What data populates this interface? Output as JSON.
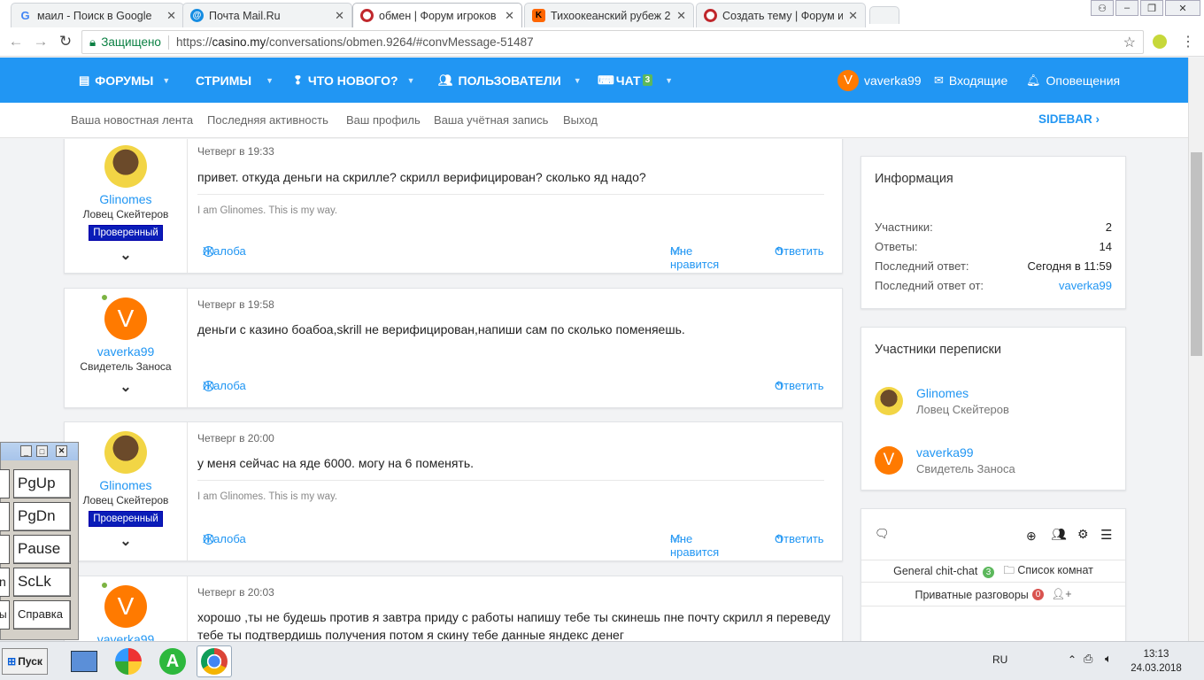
{
  "browser": {
    "tabs": [
      {
        "title": "маил - Поиск в Google",
        "favicon": "google-icon"
      },
      {
        "title": "Почта Mail.Ru",
        "favicon": "mail-ru-icon"
      },
      {
        "title": "обмен | Форум игроков",
        "favicon": "casino-icon",
        "active": true
      },
      {
        "title": "Тихоокеанский рубеж 2",
        "favicon": "kinopoisk-icon"
      },
      {
        "title": "Создать тему | Форум и",
        "favicon": "casino-icon"
      }
    ],
    "secure_label": "Защищено",
    "url_prefix": "https://",
    "url_host": "casino.my",
    "url_path": "/conversations/obmen.9264/#convMessage-51487"
  },
  "nav": {
    "forums": "ФОРУМЫ",
    "streams": "СТРИМЫ",
    "whats_new": "ЧТО НОВОГО?",
    "users": "ПОЛЬЗОВАТЕЛИ",
    "chat": "ЧАТ",
    "chat_count": "3",
    "user_initial": "V",
    "username": "vaverka99",
    "inbox": "Входящие",
    "alerts": "Оповещения"
  },
  "subnav": {
    "items": [
      "Ваша новостная лента",
      "Последняя активность",
      "Ваш профиль",
      "Ваша учётная запись",
      "Выход"
    ],
    "sidebar": "SIDEBAR"
  },
  "messages": [
    {
      "user": "Glinomes",
      "title": "Ловец Скейтеров",
      "verified": "Проверенный",
      "time": "Четверг в 19:33",
      "text": "привет. откуда деньги на скрилле? скрилл верифицирован? сколько яд надо?",
      "signature": "I am Glinomes. This is my way.",
      "report": "Жалоба",
      "like": "Мне нравится",
      "reply": "Ответить"
    },
    {
      "user": "vaverka99",
      "initial": "V",
      "title": "Свидетель Заноса",
      "time": "Четверг в 19:58",
      "text": "деньги с казино боабоа,skrill не верифицирован,напиши сам по сколько поменяешь.",
      "report": "Жалоба",
      "reply": "Ответить"
    },
    {
      "user": "Glinomes",
      "title": "Ловец Скейтеров",
      "verified": "Проверенный",
      "time": "Четверг в 20:00",
      "text": "у меня сейчас на яде 6000. могу на 6 поменять.",
      "signature": "I am Glinomes. This is my way.",
      "report": "Жалоба",
      "like": "Мне нравится",
      "reply": "Ответить"
    },
    {
      "user": "vaverka99",
      "initial": "V",
      "time": "Четверг в 20:03",
      "text": "хорошо ,ты не будешь против я завтра приду с работы напишу тебе ты скинешь пне почту скрилл я переведу тебе ты подтвердишь получения потом я скину тебе данные яндекс денег"
    }
  ],
  "info_widget": {
    "title": "Информация",
    "rows": [
      {
        "label": "Участники:",
        "value": "2"
      },
      {
        "label": "Ответы:",
        "value": "14"
      },
      {
        "label": "Последний ответ:",
        "value": "Сегодня в 11:59"
      },
      {
        "label": "Последний ответ от:",
        "value": "vaverka99"
      }
    ]
  },
  "participants_widget": {
    "title": "Участники переписки",
    "members": [
      {
        "name": "Glinomes",
        "title": "Ловец Скейтеров"
      },
      {
        "name": "vaverka99",
        "initial": "V",
        "title": "Свидетель Заноса"
      }
    ]
  },
  "chat_widget": {
    "general": "General chit-chat",
    "general_count": "3",
    "rooms": "Список комнат",
    "private": "Приватные разговоры",
    "private_count": "0"
  },
  "osk": {
    "keys": [
      "PgUp",
      "PgDn",
      "Pause",
      "ScLk",
      "Справка"
    ],
    "left_keys": [
      "",
      "",
      "",
      "n",
      "ы"
    ]
  },
  "taskbar": {
    "start": "Пуск",
    "lang": "RU",
    "time": "13:13",
    "date": "24.03.2018"
  },
  "colors": {
    "accent": "#2196f3",
    "avatar_orange": "#ff7a00",
    "verified": "#0a1db8"
  }
}
